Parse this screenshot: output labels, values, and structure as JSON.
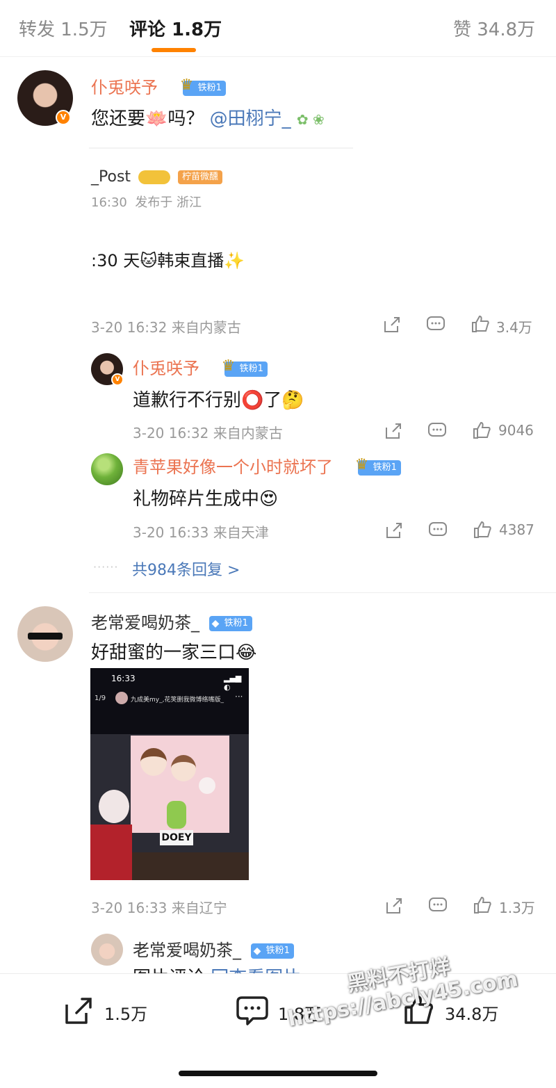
{
  "tabs": {
    "reposts": "转发 1.5万",
    "comments": "评论 1.8万",
    "likes": "赞 34.8万"
  },
  "comment1": {
    "username": "仆兎咲予",
    "fan_badge": "铁粉1",
    "text": "您还要🪷吗？",
    "mention": "@田栩宁_",
    "quoted": {
      "username": "_Post",
      "badge": "柠苗微醺",
      "time": "16:30",
      "location": "发布于 浙江",
      "content": ":30 天🐱韩束直播✨"
    },
    "meta": "3-20 16:32 来自内蒙古",
    "likes": "3.4万"
  },
  "reply1": {
    "username": "仆兎咲予",
    "fan_badge": "铁粉1",
    "text": "道歉行不行别⭕了🤔",
    "meta": "3-20 16:32 来自内蒙古",
    "likes": "9046"
  },
  "reply2": {
    "username": "青苹果好像一个小时就坏了",
    "fan_badge": "铁粉1",
    "text": "礼物碎片生成中😍",
    "meta": "3-20 16:33 来自天津",
    "likes": "4387"
  },
  "more_replies": "共984条回复 >",
  "comment2": {
    "username": "老常爱喝奶茶_",
    "fan_badge": "铁粉1",
    "text": "好甜蜜的一家三口😂",
    "photo": {
      "time": "16:33",
      "counter": "1/9",
      "caption": "九成美my_,花笑删我微博络嘴版_",
      "sign": "DOEY"
    },
    "meta": "3-20 16:33 来自辽宁",
    "likes": "1.3万"
  },
  "reply3": {
    "username": "老常爱喝奶茶_",
    "fan_badge": "铁粉1",
    "text": "图片评论",
    "link": "回查看图片"
  },
  "bottom_bar": {
    "reposts": "1.5万",
    "comments": "1.8万",
    "likes": "34.8万"
  },
  "watermark": {
    "line1": "黑料不打烊",
    "line2": "https://abcly45.com"
  },
  "colors": {
    "accent": "#ff8200",
    "username": "#eb7350",
    "link": "#4a78b8",
    "badge": "#5aa4f5"
  }
}
